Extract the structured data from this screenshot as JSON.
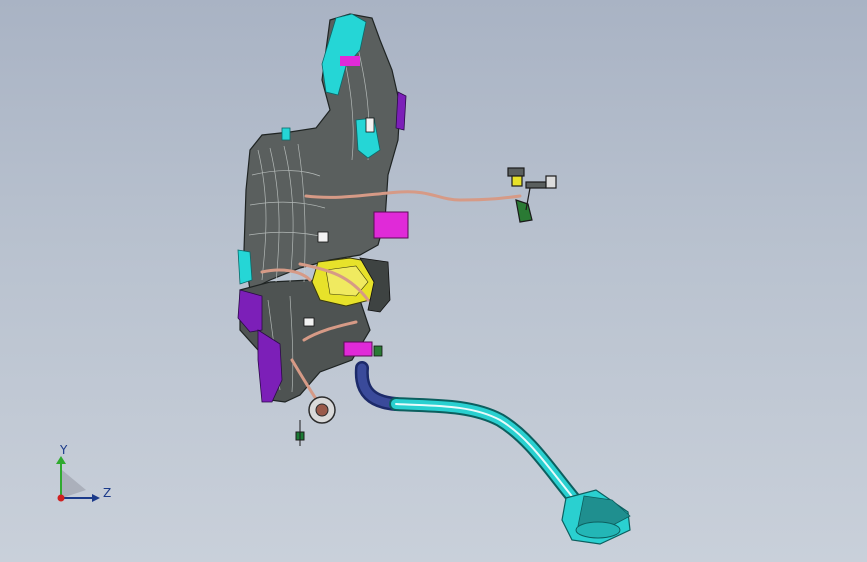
{
  "window": {
    "title": ""
  },
  "triad": {
    "y_label": "Y",
    "z_label": "Z"
  },
  "colors": {
    "background_top": "#a9b3c4",
    "background_bottom": "#c9d0da",
    "tank": "#5a5f5e",
    "cyan_part": "#25d6d6",
    "purple_part": "#7c1fb8",
    "magenta_part": "#e02ad8",
    "yellow_part": "#e7e22a",
    "pipe": "#d69a86",
    "filler_hose": "#2ad0d0",
    "axis_y": "#2faa2f",
    "axis_z": "#1b3a8a"
  },
  "parts": [
    {
      "name": "fuel-tank"
    },
    {
      "name": "filler-neck-hose"
    },
    {
      "name": "filler-cap-assembly"
    },
    {
      "name": "vapor-line"
    },
    {
      "name": "evap-bracket"
    },
    {
      "name": "magenta-canister"
    },
    {
      "name": "yellow-pump-module"
    },
    {
      "name": "sender-ring"
    }
  ]
}
